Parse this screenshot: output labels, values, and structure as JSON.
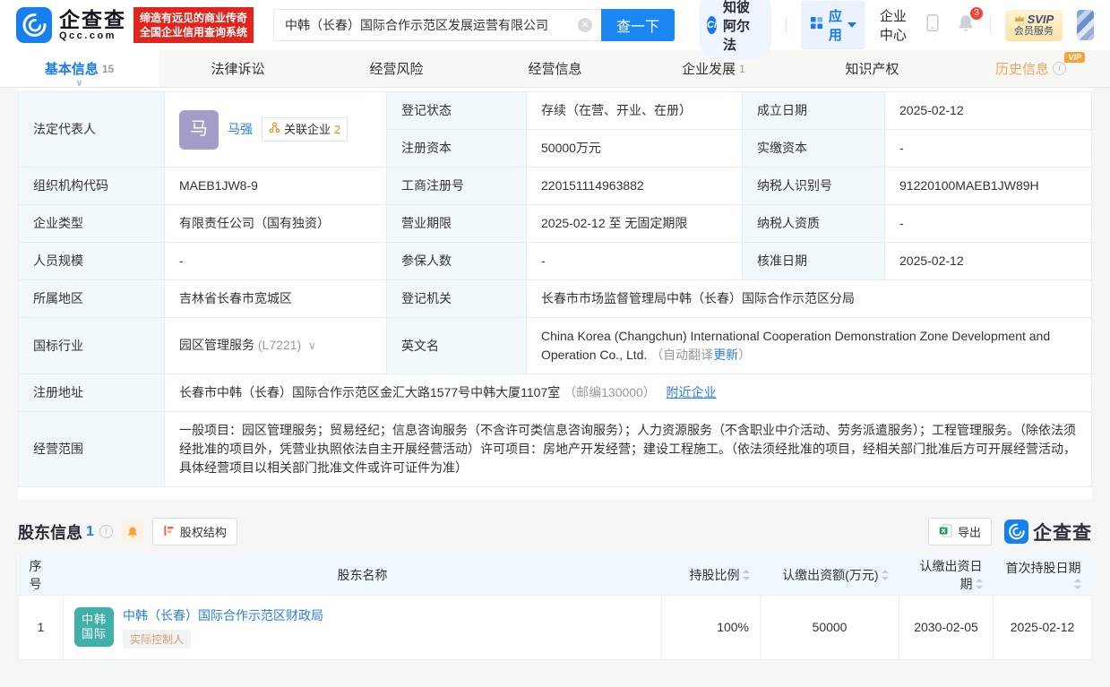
{
  "header": {
    "logo": {
      "brand_cn": "企查查",
      "brand_en": "Qcc.com",
      "slogan_line1": "缔造有远见的商业传奇",
      "slogan_line2": "全国企业信用查询系统"
    },
    "search": {
      "value": "中韩（长春）国际合作示范区发展运营有限公司",
      "button": "查一下"
    },
    "nav": {
      "zhibi": "知彼阿尔法",
      "apps": "应用",
      "enterprise_center": "企业中心",
      "notification_count": "3",
      "svip_title": "SVIP",
      "svip_sub": "会员服务"
    }
  },
  "tabs": [
    {
      "label": "基本信息",
      "count": "15"
    },
    {
      "label": "法律诉讼",
      "count": ""
    },
    {
      "label": "经营风险",
      "count": ""
    },
    {
      "label": "经营信息",
      "count": ""
    },
    {
      "label": "企业发展",
      "count": "1"
    },
    {
      "label": "知识产权",
      "count": ""
    },
    {
      "label": "历史信息",
      "count": "",
      "vip": "VIP"
    }
  ],
  "basic_info": {
    "legal_rep_label": "法定代表人",
    "legal_rep_avatar": "马",
    "legal_rep_name": "马强",
    "related_text": "关联企业",
    "related_count": "2",
    "reg_status_label": "登记状态",
    "reg_status": "存续（在营、开业、在册）",
    "est_date_label": "成立日期",
    "est_date": "2025-02-12",
    "reg_capital_label": "注册资本",
    "reg_capital": "50000万元",
    "paid_capital_label": "实缴资本",
    "paid_capital": "-",
    "org_code_label": "组织机构代码",
    "org_code": "MAEB1JW8-9",
    "biz_reg_no_label": "工商注册号",
    "biz_reg_no": "220151114963882",
    "taxpayer_id_label": "纳税人识别号",
    "taxpayer_id": "91220100MAEB1JW89H",
    "company_type_label": "企业类型",
    "company_type": "有限责任公司（国有独资）",
    "biz_term_label": "营业期限",
    "biz_term": "2025-02-12 至 无固定期限",
    "taxpayer_qual_label": "纳税人资质",
    "taxpayer_qual": "-",
    "staff_size_label": "人员规模",
    "staff_size": "-",
    "insured_label": "参保人数",
    "insured": "-",
    "approval_date_label": "核准日期",
    "approval_date": "2025-02-12",
    "region_label": "所属地区",
    "region": "吉林省长春市宽城区",
    "authority_label": "登记机关",
    "authority": "长春市市场监督管理局中韩（长春）国际合作示范区分局",
    "industry_label": "国标行业",
    "industry": "园区管理服务",
    "industry_code": "(L7221)",
    "en_name_label": "英文名",
    "en_name": "China Korea (Changchun) International Cooperation Demonstration Zone Development and Operation Co., Ltd.",
    "en_note_open": "（自动翻译",
    "en_update": "更新",
    "en_note_close": "）",
    "address_label": "注册地址",
    "address": "长春市中韩（长春）国际合作示范区金汇大路1577号中韩大厦1107室",
    "address_zip": "（邮编130000）",
    "nearby": "附近企业",
    "scope_label": "经营范围",
    "scope": "一般项目：园区管理服务；贸易经纪；信息咨询服务（不含许可类信息咨询服务）；人力资源服务（不含职业中介活动、劳务派遣服务）；工程管理服务。（除依法须经批准的项目外，凭营业执照依法自主开展经营活动）许可项目：房地产开发经营；建设工程施工。（依法须经批准的项目，经相关部门批准后方可开展经营活动，具体经营项目以相关部门批准文件或许可证件为准）"
  },
  "shareholders": {
    "title": "股东信息",
    "count": "1",
    "structure_btn": "股权结构",
    "export_btn": "导出",
    "qcc_logo_text": "企查查",
    "columns": {
      "no": "序号",
      "name": "股东名称",
      "ratio": "持股比例",
      "amount": "认缴出资额(万元)",
      "sub_date": "认缴出资日期",
      "first_date": "首次持股日期"
    },
    "rows": [
      {
        "no": "1",
        "logo_line1": "中韩",
        "logo_line2": "国际",
        "name": "中韩（长春）国际合作示范区财政局",
        "badge": "实际控制人",
        "ratio": "100%",
        "amount": "50000",
        "sub_date": "2030-02-05",
        "first_date": "2025-02-12"
      }
    ]
  },
  "colors": {
    "primary_blue": "#1a87f2",
    "link_blue": "#2a7de1",
    "brand_red": "#e2241d",
    "accent_orange": "#f5a43c",
    "shareholder_logo_teal": "#3fb1a8",
    "avatar_purple": "#a49dca",
    "excel_green": "#1f9e58",
    "notification_red": "#f0453a"
  }
}
